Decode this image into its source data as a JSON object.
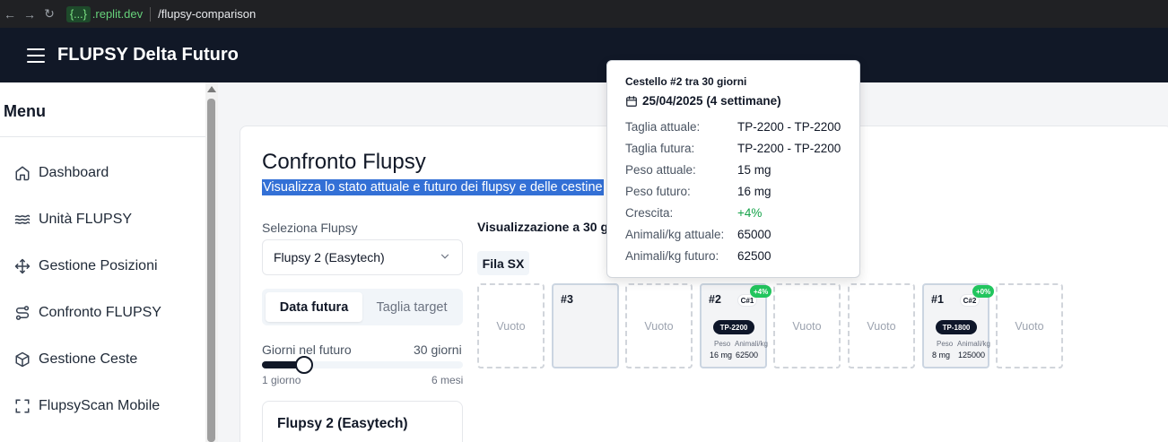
{
  "browser": {
    "url_host": "{...}",
    "url_domain": ".replit.dev",
    "url_path": "/flupsy-comparison"
  },
  "header": {
    "title": "FLUPSY Delta Futuro"
  },
  "sidebar": {
    "title": "Menu",
    "items": [
      {
        "label": "Dashboard",
        "icon": "home-icon"
      },
      {
        "label": "Unità FLUPSY",
        "icon": "waves-icon"
      },
      {
        "label": "Gestione Posizioni",
        "icon": "move-icon"
      },
      {
        "label": "Confronto FLUPSY",
        "icon": "route-icon"
      },
      {
        "label": "Gestione Ceste",
        "icon": "box-icon"
      },
      {
        "label": "FlupsyScan Mobile",
        "icon": "scan-icon"
      }
    ]
  },
  "main": {
    "title": "Confronto Flupsy",
    "subtitle": "Visualizza lo stato attuale e futuro dei flupsy e delle cestine",
    "select_label": "Seleziona Flupsy",
    "select_value": "Flupsy 2 (Easytech)",
    "tabs": [
      {
        "label": "Data futura",
        "active": true
      },
      {
        "label": "Taglia target",
        "active": false
      }
    ],
    "slider": {
      "label": "Giorni nel futuro",
      "value_text": "30 giorni",
      "min_label": "1 giorno",
      "max_label": "6 mesi",
      "fraction": 0.19
    },
    "flupsy_card_title": "Flupsy 2 (Easytech)",
    "visualization_title": "Visualizzazione a 30 gi",
    "row_label": "Fila SX",
    "slots": [
      {
        "type": "empty",
        "label": "Vuoto"
      },
      {
        "type": "basket-plain",
        "number": "#3"
      },
      {
        "type": "empty",
        "label": "Vuoto"
      },
      {
        "type": "basket",
        "number": "#2",
        "cycle": "C#1",
        "growth": "+4%",
        "size": "TP-2200",
        "weight_label": "Peso",
        "weight_value": "16 mg",
        "animals_label": "Animali/kg",
        "animals_value": "62500"
      },
      {
        "type": "empty",
        "label": "Vuoto"
      },
      {
        "type": "empty",
        "label": "Vuoto"
      },
      {
        "type": "basket",
        "number": "#1",
        "cycle": "C#2",
        "growth": "+0%",
        "size": "TP-1800",
        "weight_label": "Peso",
        "weight_value": "8 mg",
        "animals_label": "Animali/kg",
        "animals_value": "125000"
      },
      {
        "type": "empty",
        "label": "Vuoto"
      }
    ]
  },
  "tooltip": {
    "title": "Cestello #2 tra 30 giorni",
    "date": "25/04/2025 (4 settimane)",
    "rows": [
      {
        "key": "Taglia attuale:",
        "value": "TP-2200 - TP-2200"
      },
      {
        "key": "Taglia futura:",
        "value": "TP-2200 - TP-2200"
      },
      {
        "key": "Peso attuale:",
        "value": "15 mg"
      },
      {
        "key": "Peso futuro:",
        "value": "16 mg"
      },
      {
        "key": "Crescita:",
        "value": "+4%"
      },
      {
        "key": "Animali/kg attuale:",
        "value": "65000"
      },
      {
        "key": "Animali/kg futuro:",
        "value": "62500"
      }
    ]
  },
  "colors": {
    "header_bg": "#111827",
    "growth_green": "#22c55e",
    "selection_blue": "#3370d6"
  }
}
